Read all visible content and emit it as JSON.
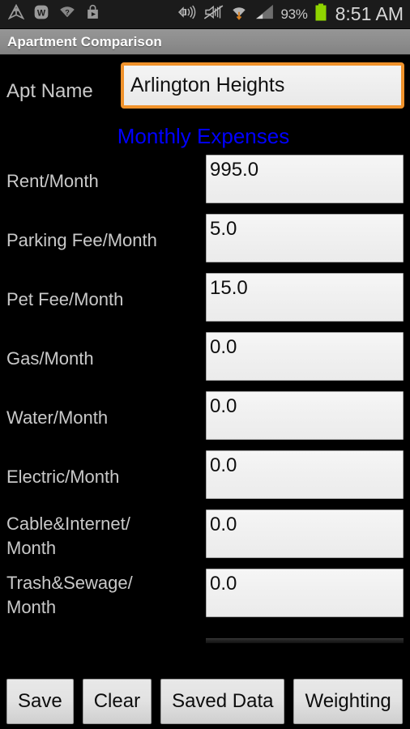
{
  "status_bar": {
    "left_icons": [
      {
        "name": "navigation-update-icon",
        "glyph": "⚠"
      },
      {
        "name": "w-app-icon",
        "glyph": "W"
      },
      {
        "name": "wifi-question-icon",
        "glyph": "?"
      },
      {
        "name": "play-store-icon",
        "glyph": "▶"
      }
    ],
    "right_icons": [
      {
        "name": "vibrate-sound-icon"
      },
      {
        "name": "mute-icon"
      },
      {
        "name": "wifi-download-icon"
      },
      {
        "name": "cell-signal-icon"
      },
      {
        "name": "battery-icon"
      }
    ],
    "battery_percent": "93%",
    "clock": "8:51 AM",
    "battery_color": "#8fd400",
    "background": "#1b1b1b"
  },
  "title_bar": {
    "title": "Apartment Comparison"
  },
  "form": {
    "apt_name": {
      "label": "Apt Name",
      "value": "Arlington Heights",
      "placeholder": "",
      "focused": true,
      "focus_color": "#f0922b"
    },
    "section_heading": "Monthly Expenses",
    "section_heading_color": "#0000ff",
    "expenses": [
      {
        "label": "Rent/Month",
        "value": "995.0"
      },
      {
        "label": "Parking Fee/Month",
        "value": "5.0"
      },
      {
        "label": "Pet Fee/Month",
        "value": "15.0"
      },
      {
        "label": "Gas/Month",
        "value": "0.0"
      },
      {
        "label": "Water/Month",
        "value": "0.0"
      },
      {
        "label": "Electric/Month",
        "value": "0.0"
      },
      {
        "label": "Cable&Internet/Month",
        "value": "0.0"
      },
      {
        "label": "Trash&Sewage/Month",
        "value": "0.0"
      }
    ]
  },
  "buttons": [
    {
      "label": "Save",
      "name": "save-button"
    },
    {
      "label": "Clear",
      "name": "clear-button"
    },
    {
      "label": "Saved Data",
      "name": "saved-data-button"
    },
    {
      "label": "Weighting",
      "name": "weighting-button"
    }
  ]
}
